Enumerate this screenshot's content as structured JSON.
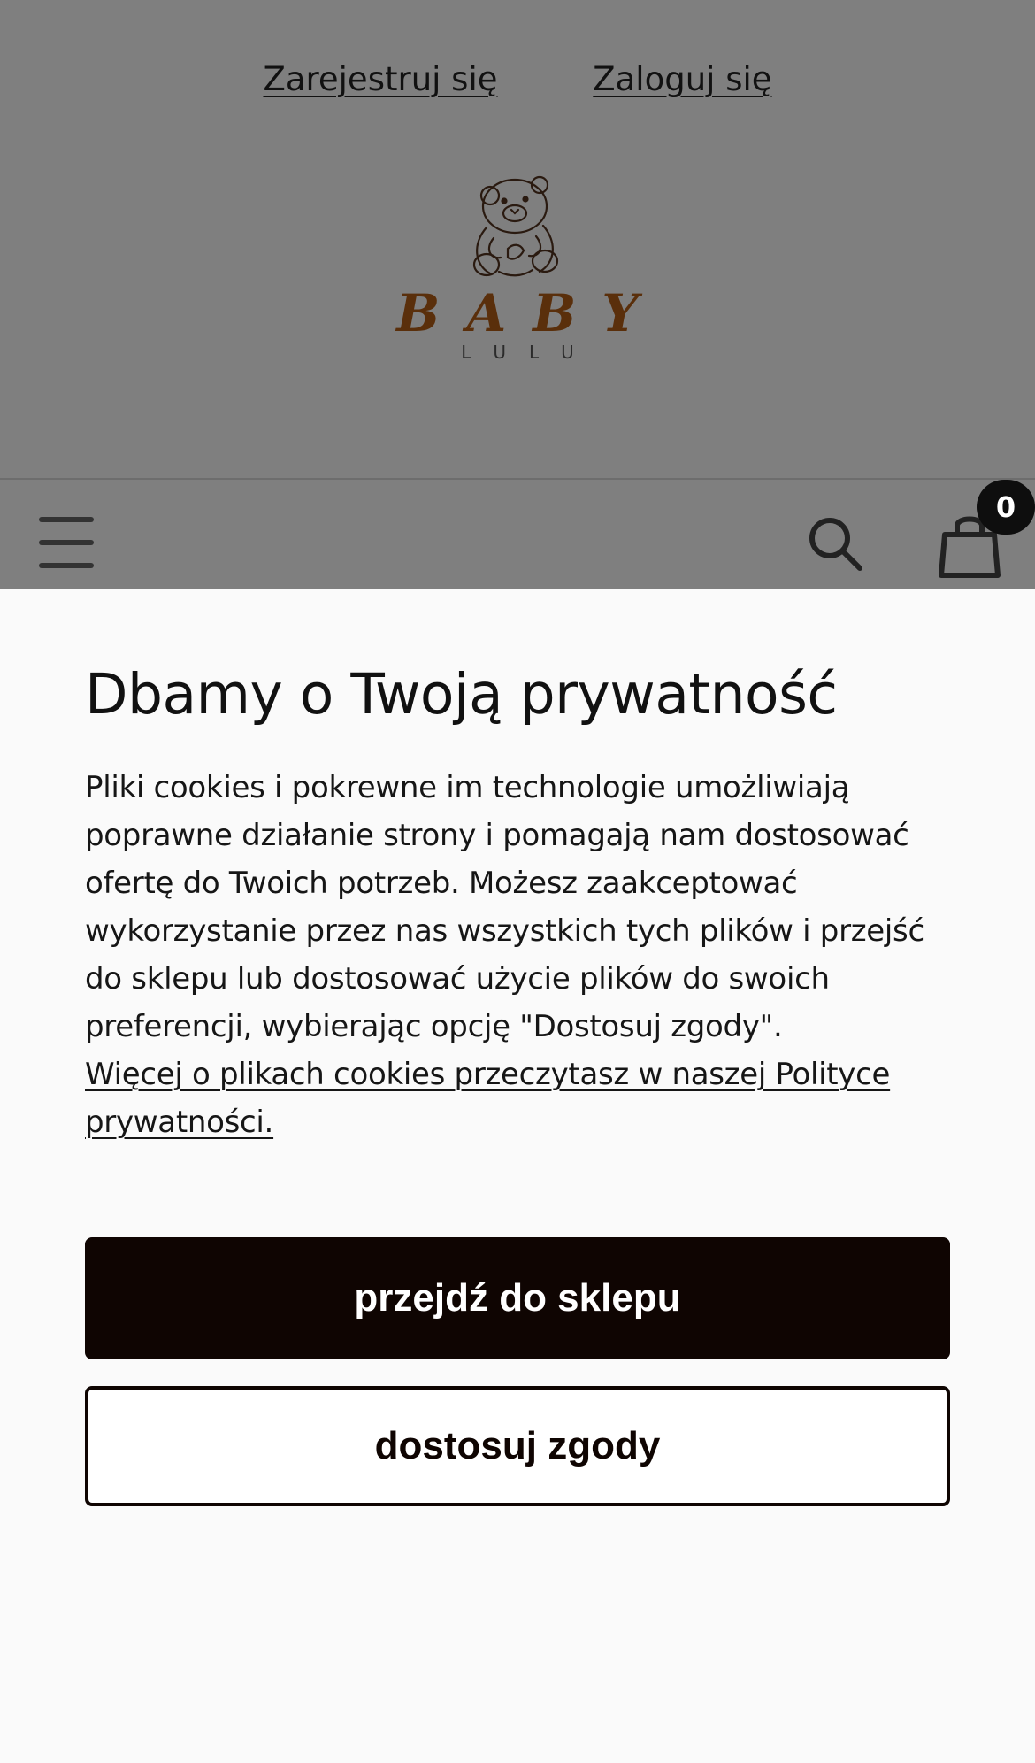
{
  "header": {
    "register_label": "Zarejestruj się",
    "login_label": "Zaloguj się",
    "logo_word": "BABY",
    "logo_sub": "LULU",
    "cart_count": "0",
    "icons": [
      "menu-icon",
      "search-icon",
      "shopping-bag-icon",
      "teddy-bear-logo"
    ]
  },
  "consent": {
    "title": "Dbamy o Twoją prywatność",
    "body": "Pliki cookies i pokrewne im technologie umożliwiają poprawne działanie strony i pomagają nam dostosować ofertę do Twoich potrzeb. Możesz zaakceptować wykorzystanie przez nas wszystkich tych plików i przejść do sklepu lub dostosować użycie plików do swoich preferencji, wybierając opcję \"Dostosuj zgody\".",
    "policy_link": "Więcej o plikach cookies przeczytasz w naszej Polityce prywatności.",
    "accept_label": "przejdź do sklepu",
    "customize_label": "dostosuj zgody"
  },
  "colors": {
    "overlay": "#7f7f7f",
    "panel": "#fafafa",
    "brand_brown": "#5a2f0b",
    "button_dark": "#0f0502"
  }
}
